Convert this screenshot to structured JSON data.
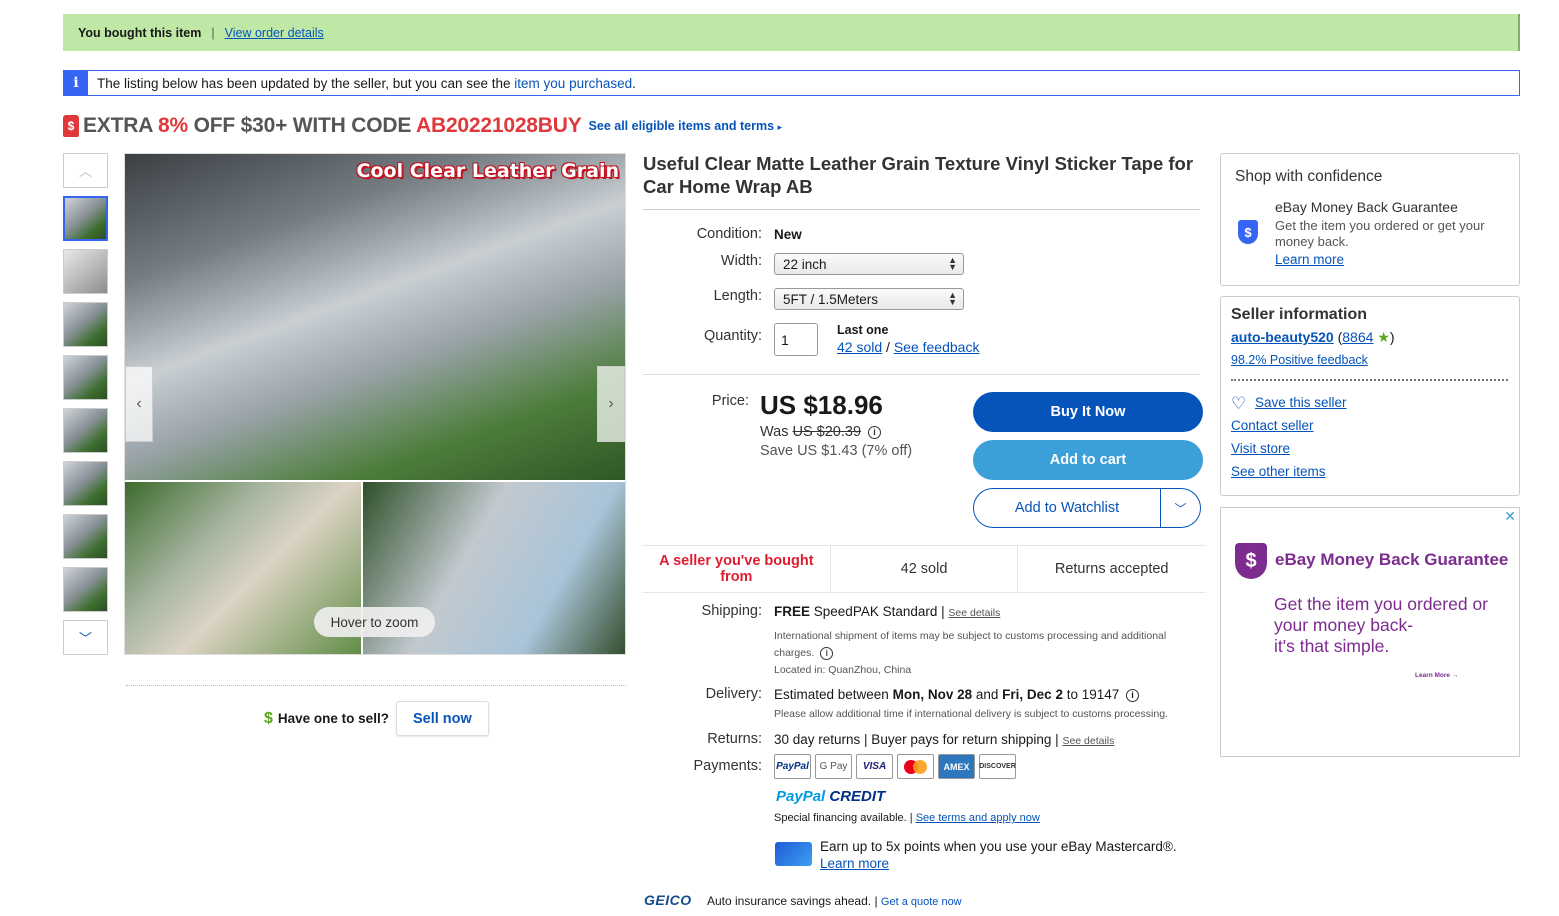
{
  "banner": {
    "bought_text": "You bought this item",
    "separator": "|",
    "order_link": "View order details",
    "info_text": "The listing below has been updated by the seller, but you can see the",
    "info_link": "item you purchased",
    "info_end": "."
  },
  "promo": {
    "tag_icon": "$",
    "part1": "EXTRA",
    "pct": "8%",
    "part2": "OFF $30+ WITH CODE",
    "code": "AB20221028BUY",
    "link": "See all eligible items and terms",
    "link_arrow": "▸"
  },
  "gallery": {
    "up_arrow": "︿",
    "down_arrow": "﹀",
    "image_caption": "Cool Clear Leather Grain",
    "prev": "‹",
    "next": "›",
    "hover": "Hover to zoom"
  },
  "sell": {
    "icon": "$",
    "text": "Have one to sell?",
    "button": "Sell now"
  },
  "item": {
    "title": "Useful Clear Matte Leather Grain Texture Vinyl Sticker Tape for Car Home Wrap AB",
    "condition_label": "Condition:",
    "condition_value": "New",
    "width_label": "Width:",
    "width_value": "22 inch",
    "length_label": "Length:",
    "length_value": "5FT / 1.5Meters",
    "quantity_label": "Quantity:",
    "quantity_value": "1",
    "last_one": "Last one",
    "sold_link": "42 sold",
    "slash": "/",
    "feedback_link": "See feedback",
    "select_arrow": "▲▼"
  },
  "pricing": {
    "price_label": "Price:",
    "price": "US $18.96",
    "was_label": "Was",
    "was_price": "US $20.39",
    "info_icon": "i",
    "save": "Save US $1.43 (7% off)",
    "buy_now": "Buy It Now",
    "add_cart": "Add to cart",
    "watchlist": "Add to Watchlist",
    "watch_dd": "﹀"
  },
  "highlights": [
    "A seller you've bought from",
    "42 sold",
    "Returns accepted"
  ],
  "shipping": {
    "label": "Shipping:",
    "free": "FREE",
    "service": "SpeedPAK Standard |",
    "details": "See details",
    "intl_note": "International shipment of items may be subject to customs processing and additional charges.",
    "info_icon": "i",
    "location": "Located in: QuanZhou, China"
  },
  "delivery": {
    "label": "Delivery:",
    "text_a": "Estimated between",
    "date1": "Mon, Nov 28",
    "and": "and",
    "date2": "Fri, Dec 2",
    "to": "to 19147",
    "info_icon": "i",
    "note": "Please allow additional time if international delivery is subject to customs processing."
  },
  "returns": {
    "label": "Returns:",
    "text": "30 day returns | Buyer pays for return shipping |",
    "details": "See details"
  },
  "payments": {
    "label": "Payments:",
    "methods": [
      "PayPal",
      "G Pay",
      "VISA",
      "",
      "AMEX",
      "DISCOVER"
    ],
    "paypal_credit_a": "PayPal",
    "paypal_credit_b": "CREDIT",
    "financing": "Special financing available. |",
    "terms_link": "See terms and apply now",
    "mastercard_text": "Earn up to 5x points when you use your eBay Mastercard®.",
    "learn_more": "Learn more"
  },
  "geico": {
    "logo": "GEICO",
    "text": "Auto insurance savings ahead. |",
    "link": "Get a quote now"
  },
  "confidence": {
    "title": "Shop with confidence",
    "shield_icon": "$",
    "mbg_title": "eBay Money Back Guarantee",
    "mbg_text": "Get the item you ordered or get your money back.",
    "learn_more": "Learn more"
  },
  "seller": {
    "title": "Seller information",
    "name": "auto-beauty520",
    "score_open": "(",
    "score": "8864",
    "star": "★",
    "score_close": ")",
    "positive": "98.2% Positive feedback",
    "heart_icon": "♡",
    "save": "Save this seller",
    "contact": "Contact seller",
    "store": "Visit store",
    "other": "See other items"
  },
  "ad": {
    "close": "✕",
    "badge": "$",
    "title": "eBay Money Back Guarantee",
    "body": "Get the item you ordered or your money back-\nit's that simple.",
    "more": "Learn More →"
  }
}
